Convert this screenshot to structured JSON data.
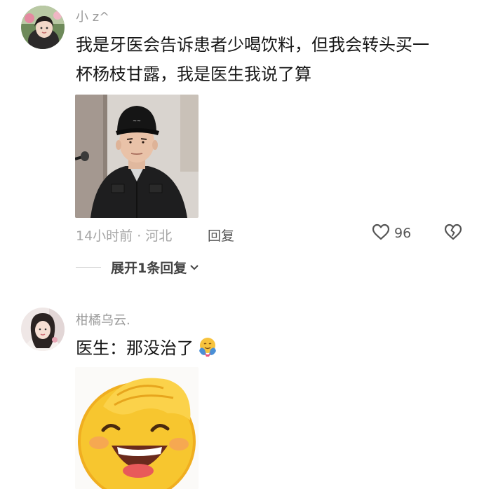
{
  "comments": [
    {
      "username": "小 z^",
      "text_line1": "我是牙医会告诉患者少喝饮料，但我会转头买一",
      "text_line2": "杯杨枝甘露，我是医生我说了算",
      "time_location": "14小时前 · 河北",
      "reply_label": "回复",
      "like_count": "96",
      "expand_replies_label": "展开1条回复"
    },
    {
      "username": "柑橘乌云.",
      "text": "医生：那没治了"
    }
  ],
  "icons": {
    "like": "heart-outline-icon",
    "dislike": "broken-heart-icon",
    "expand": "chevron-down-icon",
    "inline_emoji": "hugging-face-emoji"
  },
  "colors": {
    "username": "#9a9a9a",
    "text": "#161616",
    "meta": "#a6a6a6"
  }
}
